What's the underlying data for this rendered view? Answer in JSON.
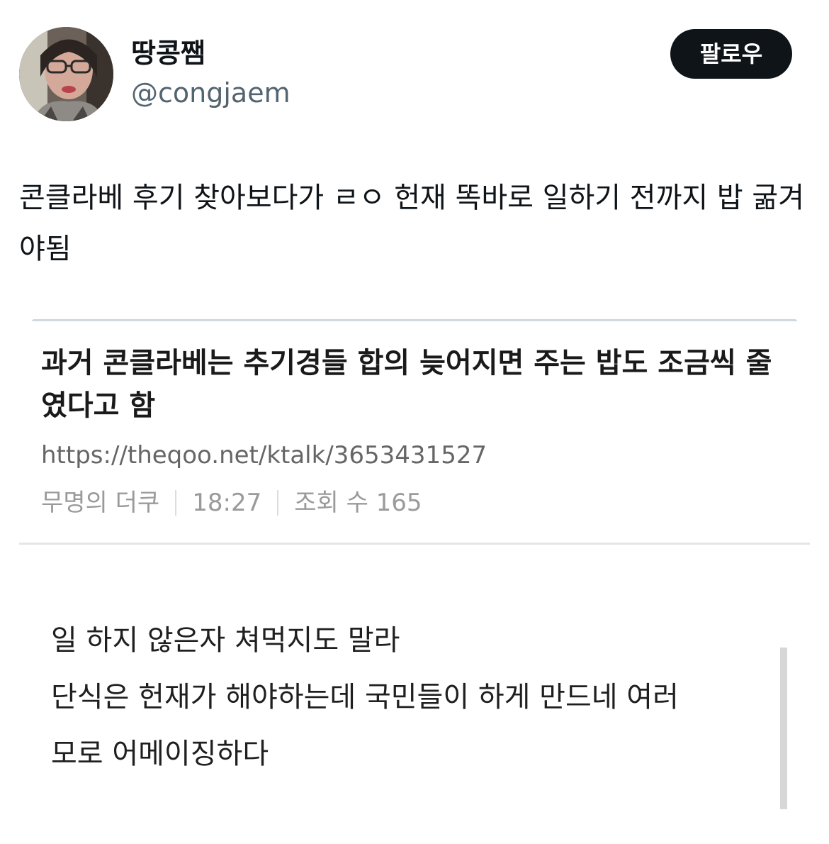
{
  "author": {
    "display_name": "땅콩쨈",
    "handle": "@congjaem"
  },
  "follow_button": {
    "label": "팔로우"
  },
  "tweet": {
    "text": "콘클라베 후기 찾아보다가 ㄹㅇ 헌재 똑바로 일하기 전까지 밥 굶겨야됨"
  },
  "embedded_post": {
    "title": "과거 콘클라베는 추기경들 합의 늦어지면 주는 밥도 조금씩 줄였다고 함",
    "url": "https://theqoo.net/ktalk/3653431527",
    "meta": {
      "author": "무명의 더쿠",
      "time": "18:27",
      "views": "조회 수 165"
    },
    "body_lines": [
      "일 하지 않은자 쳐먹지도 말라",
      "단식은 헌재가 해야하는데 국민들이 하게 만드네 여러",
      "모로 어메이징하다"
    ]
  },
  "colors": {
    "follow_button_bg": "#0f1419",
    "handle": "#536471",
    "meta": "#9a9a9a"
  }
}
